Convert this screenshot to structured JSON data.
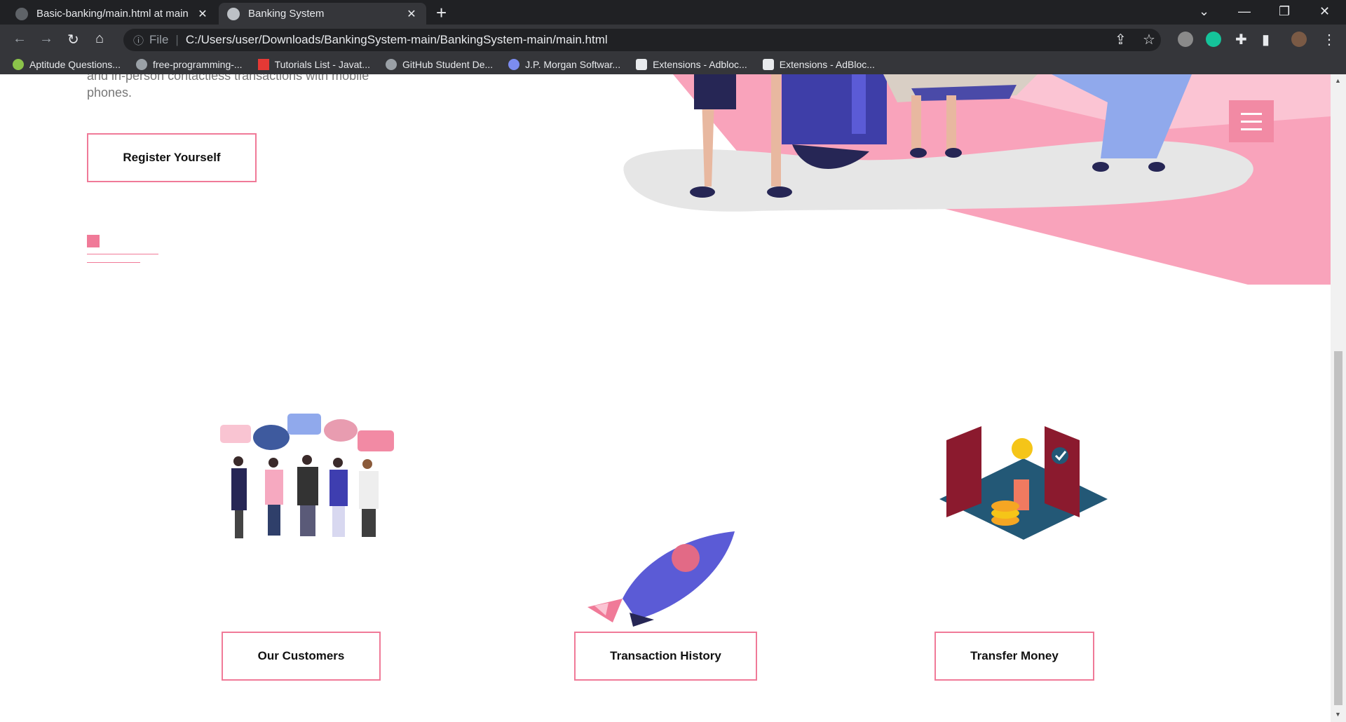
{
  "browser": {
    "tabs": [
      {
        "title": "Basic-banking/main.html at main",
        "active": false
      },
      {
        "title": "Banking System",
        "active": true
      }
    ],
    "address": {
      "scheme": "File",
      "url": "C:/Users/user/Downloads/BankingSystem-main/BankingSystem-main/main.html"
    },
    "bookmarks": [
      {
        "label": "Aptitude Questions..."
      },
      {
        "label": "free-programming-..."
      },
      {
        "label": "Tutorials List - Javat..."
      },
      {
        "label": "GitHub Student De..."
      },
      {
        "label": "J.P. Morgan Softwar..."
      },
      {
        "label": "Extensions - Adbloc..."
      },
      {
        "label": "Extensions - AdBloc..."
      }
    ]
  },
  "hero": {
    "intro_text": "and in-person contactless transactions with mobile phones.",
    "register_button": "Register Yourself"
  },
  "features": [
    {
      "label": "Our Customers",
      "illustration": "people-with-speech-bubbles"
    },
    {
      "label": "Transaction History",
      "illustration": "rocket"
    },
    {
      "label": "Transfer Money",
      "illustration": "isometric-money-doors"
    }
  ],
  "colors": {
    "accent": "#f07a98",
    "hero_pink": "#f9a3bb",
    "chrome_dark": "#202124",
    "chrome_mid": "#35363a"
  }
}
